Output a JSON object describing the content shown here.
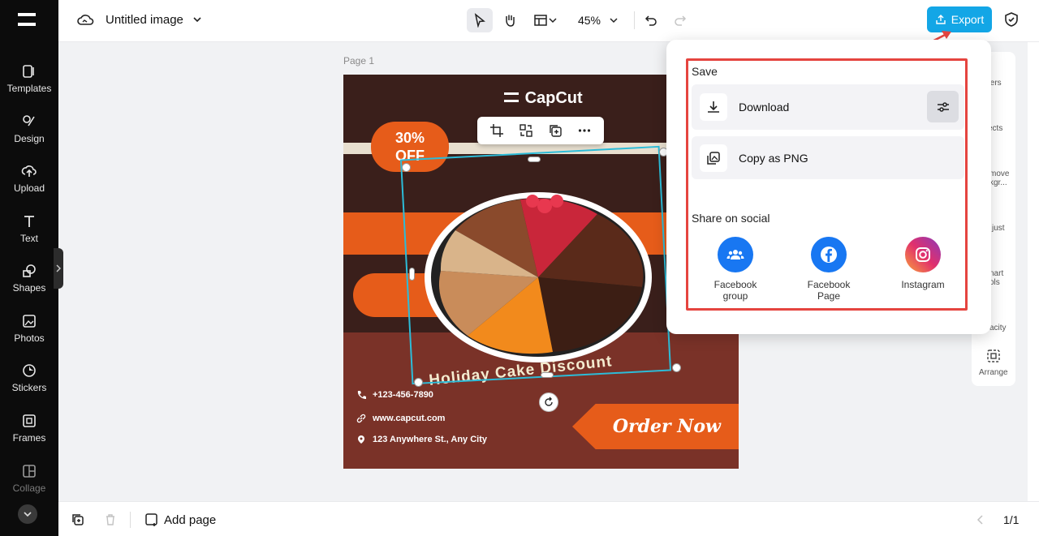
{
  "sidebar": {
    "items": [
      {
        "label": "Templates",
        "icon": "templates-icon"
      },
      {
        "label": "Design",
        "icon": "design-icon"
      },
      {
        "label": "Upload",
        "icon": "upload-icon"
      },
      {
        "label": "Text",
        "icon": "text-icon"
      },
      {
        "label": "Shapes",
        "icon": "shapes-icon"
      },
      {
        "label": "Photos",
        "icon": "photos-icon"
      },
      {
        "label": "Stickers",
        "icon": "stickers-icon"
      },
      {
        "label": "Frames",
        "icon": "frames-icon"
      },
      {
        "label": "Collage",
        "icon": "collage-icon"
      }
    ]
  },
  "topbar": {
    "title": "Untitled image",
    "zoom": "45%",
    "export_label": "Export"
  },
  "canvas": {
    "page_label": "Page 1",
    "artboard": {
      "brand": "CapCut",
      "badge_line1": "30%",
      "badge_line2": "OFF",
      "arc_text": "Holiday Cake Discount",
      "phone": "+123-456-7890",
      "website": "www.capcut.com",
      "address": "123 Anywhere St., Any City",
      "cta": "Order Now"
    }
  },
  "right_rail": {
    "labels": [
      "ters",
      "ects",
      "move\nkgr...",
      "just",
      "nart\nols",
      "acity",
      "Arrange"
    ]
  },
  "export_popover": {
    "save_heading": "Save",
    "download_label": "Download",
    "copy_label": "Copy as PNG",
    "share_heading": "Share on social",
    "social": [
      {
        "label_line1": "Facebook",
        "label_line2": "group",
        "color": "#1877f2"
      },
      {
        "label_line1": "Facebook",
        "label_line2": "Page",
        "color": "#1877f2"
      },
      {
        "label_line1": "Instagram",
        "label_line2": "",
        "color": "#e1306c"
      }
    ]
  },
  "bottombar": {
    "add_page_label": "Add page",
    "page_count": "1/1"
  },
  "colors": {
    "accent": "#13a6e6",
    "highlight": "#e5443f",
    "artboard_orange": "#e65c1a"
  }
}
